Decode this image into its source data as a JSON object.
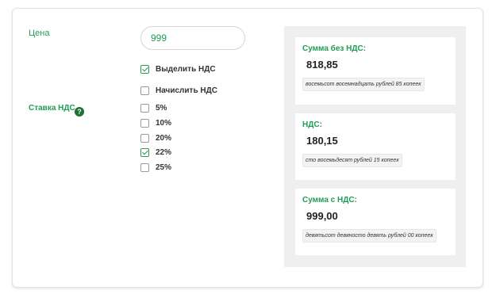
{
  "form": {
    "price_label": "Цена",
    "price_value": "999",
    "vat_rate_label": "Ставка НДС",
    "help_glyph": "?",
    "mode_options": [
      {
        "label": "Выделить НДС",
        "checked": true
      },
      {
        "label": "Начислить НДС",
        "checked": false
      }
    ],
    "rate_options": [
      {
        "label": "5%",
        "checked": false
      },
      {
        "label": "10%",
        "checked": false
      },
      {
        "label": "20%",
        "checked": false
      },
      {
        "label": "22%",
        "checked": true
      },
      {
        "label": "25%",
        "checked": false
      }
    ]
  },
  "results": [
    {
      "title": "Сумма без НДС:",
      "value": "818,85",
      "words": "восемьсот восемнадцать рублей 85 копеек"
    },
    {
      "title": "НДС:",
      "value": "180,15",
      "words": "сто восемьдесят рублей 15 копеек"
    },
    {
      "title": "Сумма с НДС:",
      "value": "999,00",
      "words": "девятьсот девяносто девять рублей 00 копеек"
    }
  ],
  "colors": {
    "accent": "#1f9d55",
    "check": "#2e9c56",
    "panel_bg": "#efefef"
  },
  "icons": {
    "help": "help-icon",
    "check": "checkmark-icon"
  }
}
